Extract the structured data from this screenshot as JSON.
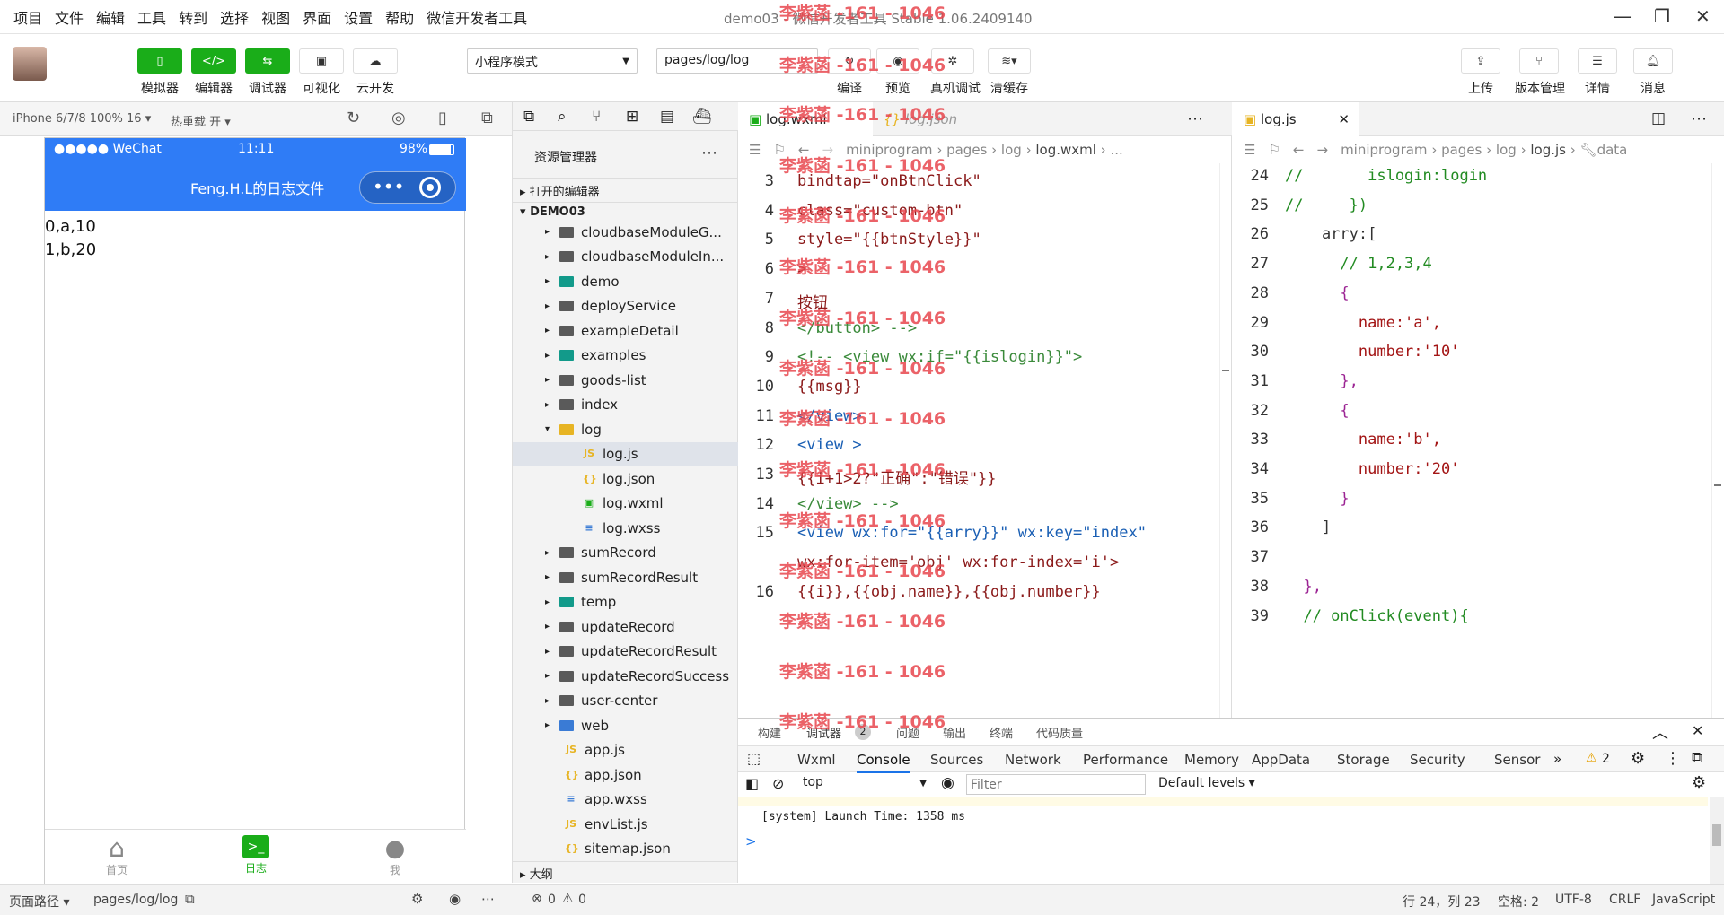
{
  "menubar": {
    "items": [
      "项目",
      "文件",
      "编辑",
      "工具",
      "转到",
      "选择",
      "视图",
      "界面",
      "设置",
      "帮助",
      "微信开发者工具"
    ],
    "window_title": "demo03 - 微信开发者工具 Stable 1.06.2409140"
  },
  "toolbar": {
    "buttons": [
      "模拟器",
      "编辑器",
      "调试器",
      "可视化",
      "云开发"
    ],
    "mode_select": "小程序模式",
    "page_select": "pages/log/log",
    "actions": [
      "编译",
      "预览",
      "真机调试",
      "清缓存"
    ],
    "right_actions": [
      "上传",
      "版本管理",
      "详情",
      "消息"
    ]
  },
  "simulator": {
    "device": "iPhone 6/7/8 100% 16 ▾",
    "hot_reload": "热重载 开 ▾",
    "status_carrier": "●●●●● WeChat",
    "status_time": "11:11",
    "status_battery": "98%",
    "nav_title": "Feng.H.L的日志文件",
    "content_lines": [
      "0,a,10",
      "1,b,20"
    ],
    "tabs": [
      "首页",
      "日志",
      "我"
    ]
  },
  "explorer": {
    "title": "资源管理器",
    "open_editors": "打开的编辑器",
    "project": "DEMO03",
    "outline": "大纲",
    "items": [
      {
        "name": "cloudbaseModuleG...",
        "type": "folder",
        "color": "gray",
        "indent": 1
      },
      {
        "name": "cloudbaseModuleIn...",
        "type": "folder",
        "color": "gray",
        "indent": 1
      },
      {
        "name": "demo",
        "type": "folder",
        "color": "teal",
        "indent": 1
      },
      {
        "name": "deployService",
        "type": "folder",
        "color": "gray",
        "indent": 1
      },
      {
        "name": "exampleDetail",
        "type": "folder",
        "color": "gray",
        "indent": 1
      },
      {
        "name": "examples",
        "type": "folder",
        "color": "teal",
        "indent": 1
      },
      {
        "name": "goods-list",
        "type": "folder",
        "color": "gray",
        "indent": 1
      },
      {
        "name": "index",
        "type": "folder",
        "color": "gray",
        "indent": 1
      },
      {
        "name": "log",
        "type": "folder-open",
        "color": "yellow",
        "indent": 1
      },
      {
        "name": "log.js",
        "type": "js",
        "indent": 2,
        "selected": true
      },
      {
        "name": "log.json",
        "type": "json",
        "indent": 2
      },
      {
        "name": "log.wxml",
        "type": "wxml",
        "indent": 2
      },
      {
        "name": "log.wxss",
        "type": "wxss",
        "indent": 2
      },
      {
        "name": "sumRecord",
        "type": "folder",
        "color": "gray",
        "indent": 1
      },
      {
        "name": "sumRecordResult",
        "type": "folder",
        "color": "gray",
        "indent": 1
      },
      {
        "name": "temp",
        "type": "folder",
        "color": "teal",
        "indent": 1
      },
      {
        "name": "updateRecord",
        "type": "folder",
        "color": "gray",
        "indent": 1
      },
      {
        "name": "updateRecordResult",
        "type": "folder",
        "color": "gray",
        "indent": 1
      },
      {
        "name": "updateRecordSuccess",
        "type": "folder",
        "color": "gray",
        "indent": 1
      },
      {
        "name": "user-center",
        "type": "folder",
        "color": "gray",
        "indent": 1
      },
      {
        "name": "web",
        "type": "folder",
        "color": "blue",
        "indent": 1
      },
      {
        "name": "app.js",
        "type": "js",
        "indent": 0
      },
      {
        "name": "app.json",
        "type": "json",
        "indent": 0
      },
      {
        "name": "app.wxss",
        "type": "wxss",
        "indent": 0
      },
      {
        "name": "envList.js",
        "type": "js",
        "indent": 0
      },
      {
        "name": "sitemap.json",
        "type": "json",
        "indent": 0
      }
    ]
  },
  "editor1": {
    "tab_active": "log.wxml",
    "tab_other": "log.json",
    "breadcrumb": [
      "miniprogram",
      "pages",
      "log",
      "log.wxml",
      "..."
    ],
    "lines": [
      {
        "n": "3",
        "t": "bindtap=\"onBtnClick\""
      },
      {
        "n": "4",
        "t": "class=\"custom-btn\""
      },
      {
        "n": "5",
        "t": "style=\"{{btnStyle}}\""
      },
      {
        "n": "6",
        "t": ">"
      },
      {
        "n": "7",
        "t": "按钮"
      },
      {
        "n": "8",
        "t": "</button> -->"
      },
      {
        "n": "9",
        "t": "<!-- <view wx:if=\"{{islogin}}\">"
      },
      {
        "n": "10",
        "t": "{{msg}}"
      },
      {
        "n": "11",
        "t": "</view>"
      },
      {
        "n": "12",
        "t": "<view >"
      },
      {
        "n": "13",
        "t": "{{i+1>2?\"正确\":\"错误\"}}"
      },
      {
        "n": "14",
        "t": "</view> -->"
      },
      {
        "n": "15",
        "t": "<view wx:for=\"{{arry}}\" wx:key=\"index\""
      },
      {
        "n": "",
        "t": "wx:for-item='obj' wx:for-index='i'>"
      },
      {
        "n": "16",
        "t": "{{i}},{{obj.name}},{{obj.number}}"
      }
    ]
  },
  "editor2": {
    "tab_active": "log.js",
    "breadcrumb": [
      "miniprogram",
      "pages",
      "log",
      "log.js",
      "data"
    ],
    "lines": [
      {
        "n": "24",
        "t": "//       islogin:login"
      },
      {
        "n": "25",
        "t": "//     })"
      },
      {
        "n": "26",
        "t": "    arry:["
      },
      {
        "n": "27",
        "t": "      // 1,2,3,4"
      },
      {
        "n": "28",
        "t": "      {"
      },
      {
        "n": "29",
        "t": "        name:'a',"
      },
      {
        "n": "30",
        "t": "        number:'10'"
      },
      {
        "n": "31",
        "t": "      },"
      },
      {
        "n": "32",
        "t": "      {"
      },
      {
        "n": "33",
        "t": "        name:'b',"
      },
      {
        "n": "34",
        "t": "        number:'20'"
      },
      {
        "n": "35",
        "t": "      }"
      },
      {
        "n": "36",
        "t": "    ]"
      },
      {
        "n": "37",
        "t": ""
      },
      {
        "n": "38",
        "t": "  },"
      },
      {
        "n": "39",
        "t": "  // onClick(event){"
      }
    ]
  },
  "devtools": {
    "top_tabs": [
      "构建",
      "调试器",
      "问题",
      "输出",
      "终端",
      "代码质量"
    ],
    "debugger_badge": "2",
    "tabs": [
      "Wxml",
      "Console",
      "Sources",
      "Network",
      "Performance",
      "Memory",
      "AppData",
      "Storage",
      "Security",
      "Sensor"
    ],
    "warn_count": "2",
    "context": "top",
    "filter_placeholder": "Filter",
    "levels": "Default levels ▾",
    "log_line": "[system] Launch Time: 1358 ms",
    "prompt": ">"
  },
  "statusbar": {
    "path_label": "页面路径 ▾",
    "path": "pages/log/log",
    "errors": "0",
    "warnings": "0",
    "cursor": "行 24，列 23",
    "spaces": "空格: 2",
    "encoding": "UTF-8",
    "eol": "CRLF",
    "lang": "JavaScript"
  },
  "watermark": "李紫菡 -161 - 1046"
}
